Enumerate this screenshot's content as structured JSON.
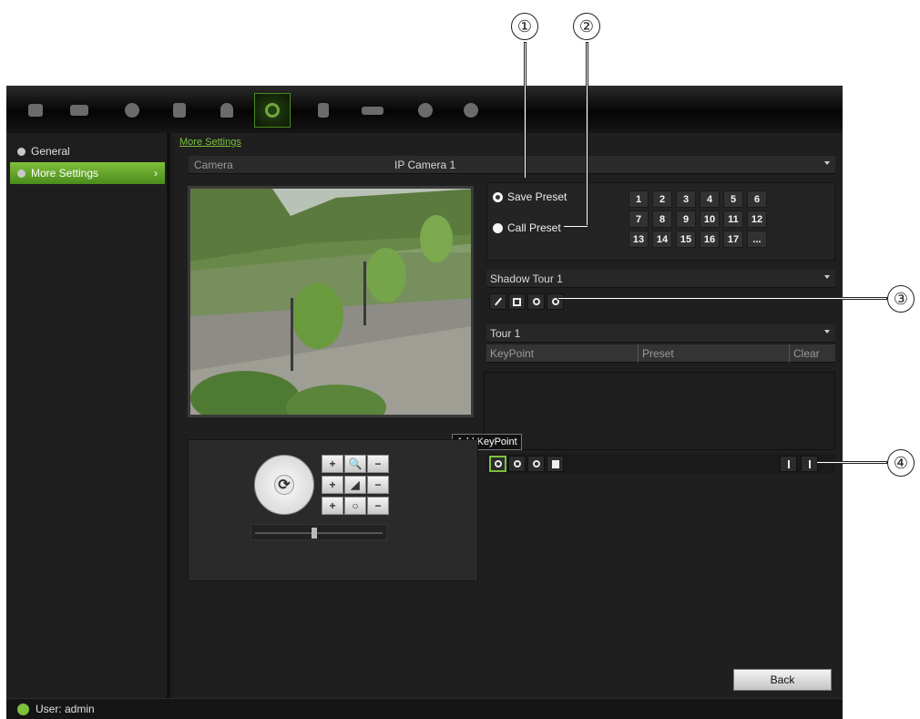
{
  "callouts": [
    "①",
    "②",
    "③",
    "④"
  ],
  "topbar": {
    "icons": [
      "monitor-icon",
      "camera-icon",
      "record-icon",
      "network-icon",
      "alarm-icon",
      "ptz-icon",
      "security-icon",
      "storage-icon",
      "info-icon",
      "power-icon"
    ],
    "active": "ptz-icon"
  },
  "sidebar": {
    "items": [
      {
        "label": "General"
      },
      {
        "label": "More Settings"
      }
    ]
  },
  "main": {
    "breadcrumb": "More Settings",
    "camera_label": "Camera",
    "camera_value": "IP Camera 1",
    "presets": {
      "save_label": "Save Preset",
      "call_label": "Call Preset",
      "selected": "Save Preset",
      "numbers": [
        "1",
        "2",
        "3",
        "4",
        "5",
        "6",
        "7",
        "8",
        "9",
        "10",
        "11",
        "12",
        "13",
        "14",
        "15",
        "16",
        "17",
        "..."
      ]
    },
    "shadow_tour": "Shadow Tour 1",
    "tour": "Tour 1",
    "table_headers": [
      "KeyPoint",
      "Preset",
      "Clear"
    ],
    "tooltip": "Add KeyPoint",
    "back_label": "Back"
  },
  "status": {
    "user_text": "User: admin"
  },
  "colors": {
    "accent": "#7dc03a",
    "background": "#1f1f1f"
  }
}
